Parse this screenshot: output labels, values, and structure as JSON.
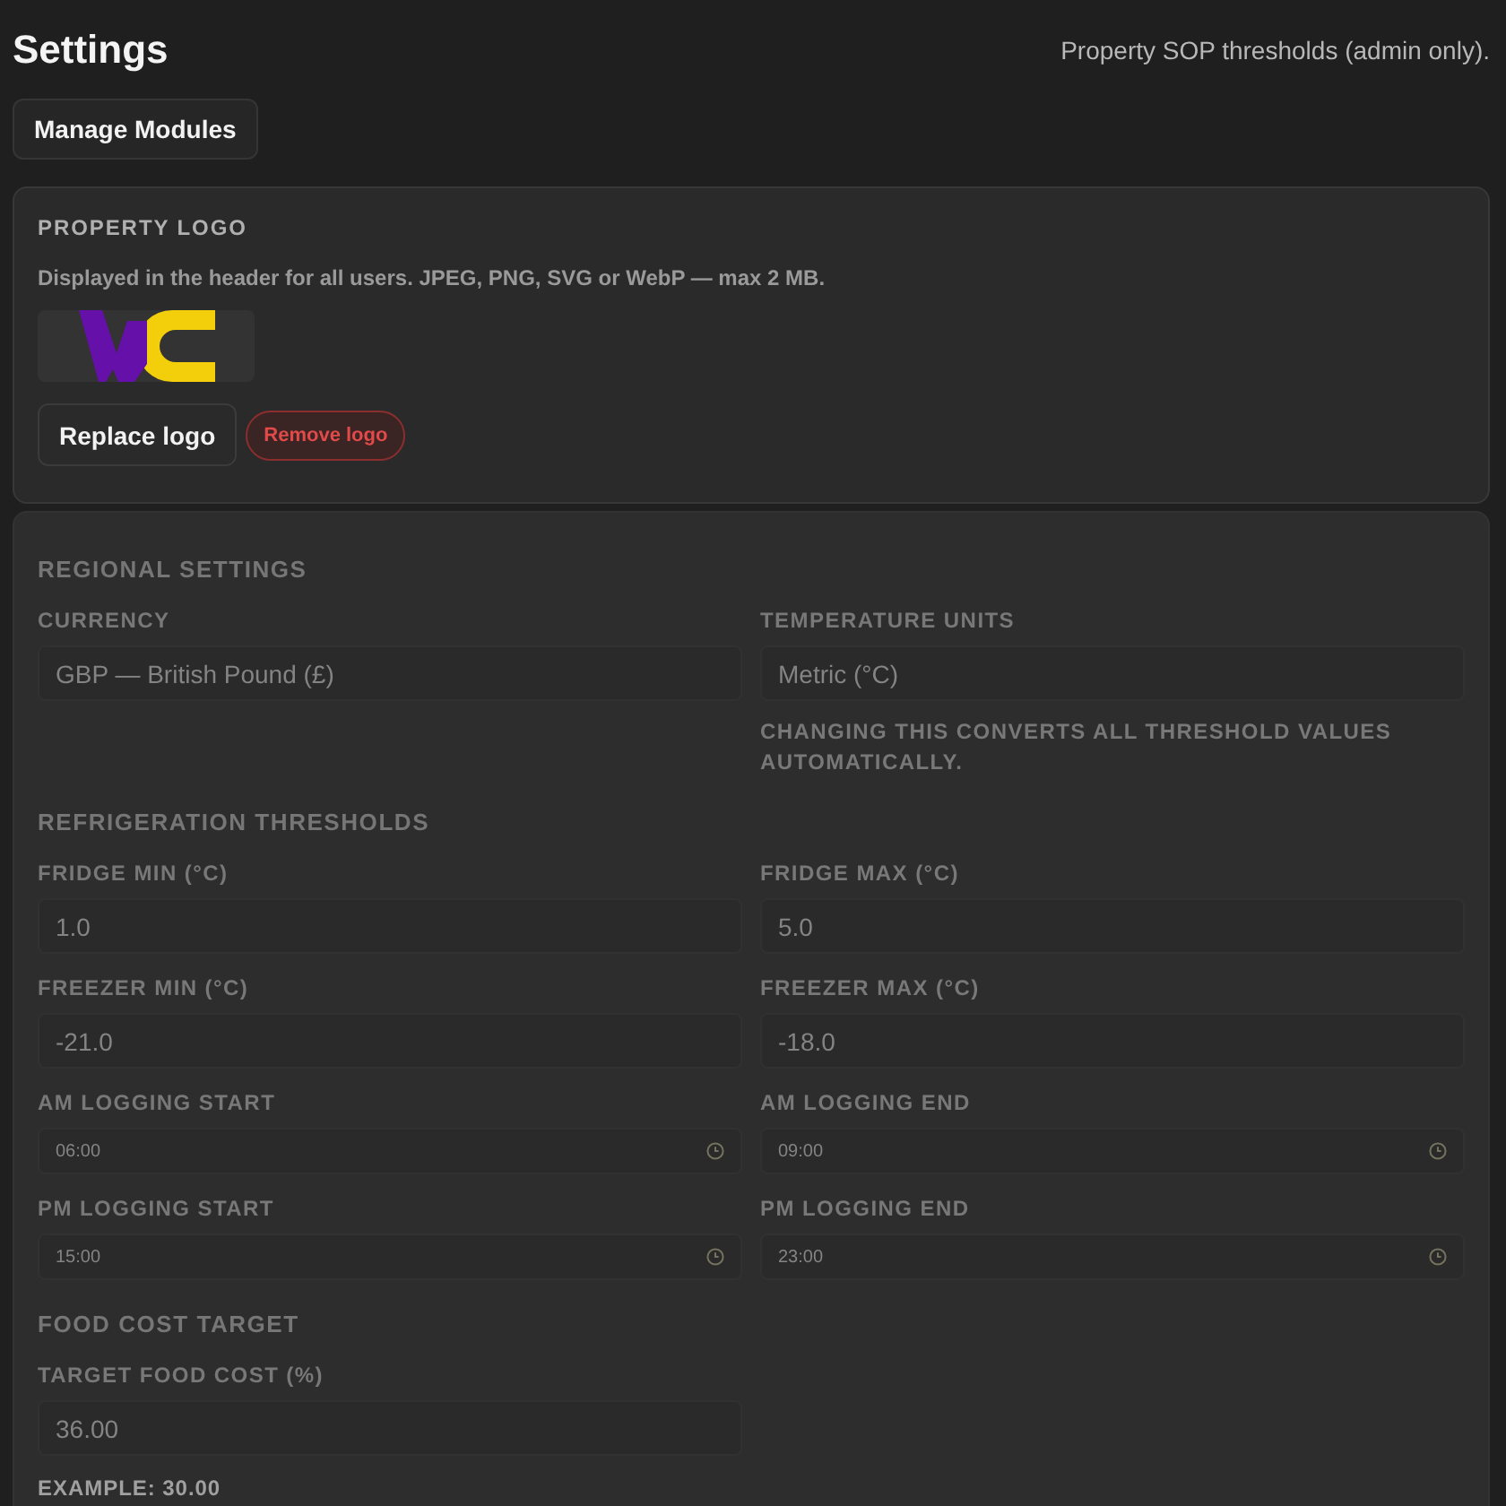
{
  "header": {
    "title": "Settings",
    "subtitle": "Property SOP thresholds (admin only)."
  },
  "manage_button": {
    "label": "Manage Modules"
  },
  "logo_card": {
    "heading": "PROPERTY LOGO",
    "description": "Displayed in the header for all users. JPEG, PNG, SVG or WebP — max 2 MB.",
    "buttons": [
      {
        "label": "Replace logo",
        "kind": "secondary"
      },
      {
        "label": "Remove logo",
        "kind": "danger"
      }
    ]
  },
  "thresholds": {
    "disabled": true,
    "sections": [
      {
        "heading": "REGIONAL SETTINGS",
        "fields": [
          {
            "label": "CURRENCY",
            "value": "GBP — British Pound (£)",
            "kind": "select"
          },
          {
            "label": "TEMPERATURE UNITS",
            "value": "Metric (°C)",
            "kind": "select",
            "hint": "CHANGING THIS CONVERTS ALL THRESHOLD VALUES AUTOMATICALLY."
          }
        ]
      },
      {
        "heading": "REFRIGERATION THRESHOLDS",
        "fields": [
          {
            "label": "FRIDGE MIN (°C)",
            "value": "1.0",
            "kind": "number"
          },
          {
            "label": "FRIDGE MAX (°C)",
            "value": "5.0",
            "kind": "number"
          },
          {
            "label": "FREEZER MIN (°C)",
            "value": "-21.0",
            "kind": "number"
          },
          {
            "label": "FREEZER MAX (°C)",
            "value": "-18.0",
            "kind": "number"
          },
          {
            "label": "AM LOGGING START",
            "value": "06:00",
            "kind": "time"
          },
          {
            "label": "AM LOGGING END",
            "value": "09:00",
            "kind": "time"
          },
          {
            "label": "PM LOGGING START",
            "value": "15:00",
            "kind": "time"
          },
          {
            "label": "PM LOGGING END",
            "value": "23:00",
            "kind": "time"
          }
        ]
      },
      {
        "heading": "FOOD COST TARGET",
        "fields": [
          {
            "label": "TARGET FOOD COST (%)",
            "value": "36.00",
            "kind": "number",
            "example": "EXAMPLE: 30.00"
          }
        ]
      }
    ]
  }
}
